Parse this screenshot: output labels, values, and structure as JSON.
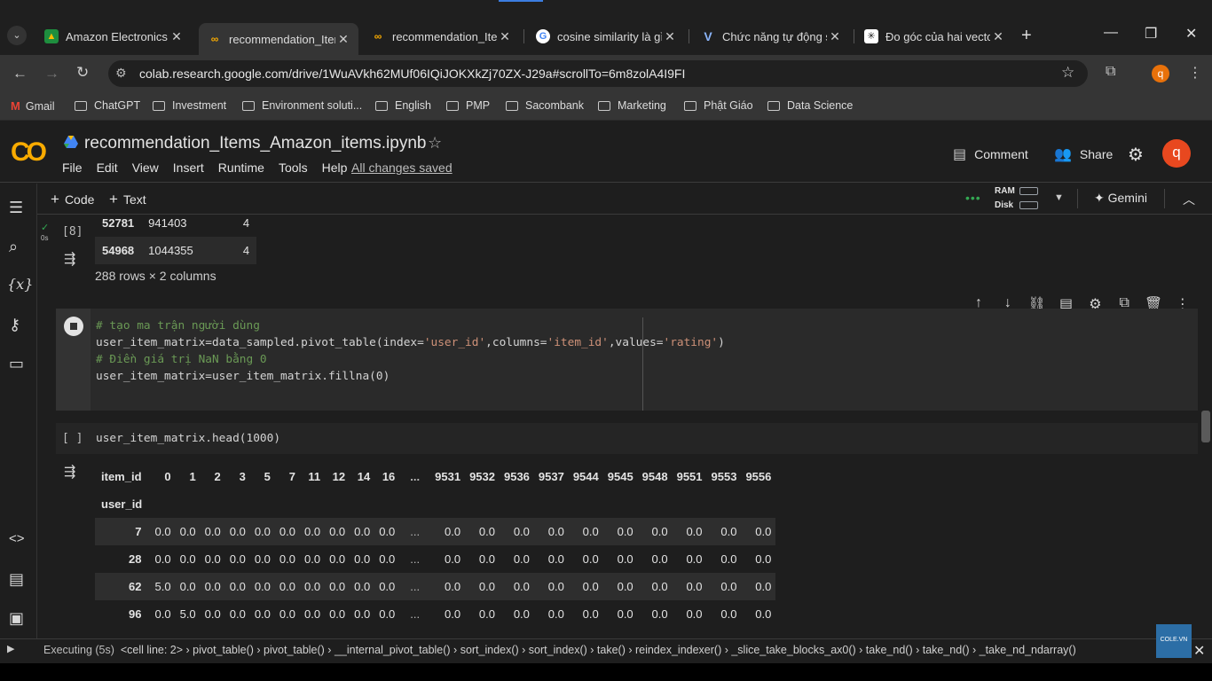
{
  "browser": {
    "tabs": [
      {
        "label": "Amazon Electronics P",
        "favicon": "drive-icon"
      },
      {
        "label": "recommendation_Iter",
        "favicon": "colab-icon",
        "active": true
      },
      {
        "label": "recommendation_Iter",
        "favicon": "colab-icon"
      },
      {
        "label": "cosine similarity là gì",
        "favicon": "google-icon"
      },
      {
        "label": "Chức năng tự động s",
        "favicon": "v-icon"
      },
      {
        "label": "Đo góc của hai vectơ",
        "favicon": "gemini-icon"
      }
    ],
    "url": "colab.research.google.com/drive/1WuAVkh62MUf06IQiJOKXkZj70ZX-J29a#scrollTo=6m8zolA4I9FI",
    "profile_initial": "q",
    "bookmarks": [
      "Gmail",
      "ChatGPT",
      "Investment",
      "Environment soluti...",
      "English",
      "PMP",
      "Sacombank",
      "Marketing",
      "Phật Giáo",
      "Data Science"
    ]
  },
  "colab": {
    "logo": "CO",
    "title": "recommendation_Items_Amazon_items.ipynb",
    "menu": [
      "File",
      "Edit",
      "View",
      "Insert",
      "Runtime",
      "Tools",
      "Help"
    ],
    "saved": "All changes saved",
    "comment": "Comment",
    "share": "Share",
    "avatar": "q",
    "add_code": "Code",
    "add_text": "Text",
    "ram": "RAM",
    "disk": "Disk",
    "gemini": "Gemini"
  },
  "cell_prev": {
    "exec": "[8]",
    "exec_time": "0s",
    "rows": [
      [
        "52781",
        "941403",
        "4"
      ],
      [
        "54968",
        "1044355",
        "4"
      ]
    ],
    "info": "288 rows × 2 columns"
  },
  "cell1": {
    "line1": "# tạo ma trận người dùng",
    "line2_a": "user_item_matrix=data_sampled.pivot_table(index=",
    "line2_s1": "'user_id'",
    "line2_b": ",columns=",
    "line2_s2": "'item_id'",
    "line2_c": ",values=",
    "line2_s3": "'rating'",
    "line2_d": ")",
    "line3": "# Điền giá trị NaN bằng 0",
    "line4": "user_item_matrix=user_item_matrix.fillna(0)"
  },
  "cell2": {
    "exec": "[ ]",
    "code": "user_item_matrix.head(1000)"
  },
  "dataframe": {
    "col_header_label": "item_id",
    "row_header_label": "user_id",
    "columns": [
      "0",
      "1",
      "2",
      "3",
      "5",
      "7",
      "11",
      "12",
      "14",
      "16",
      "...",
      "9531",
      "9532",
      "9536",
      "9537",
      "9544",
      "9545",
      "9548",
      "9551",
      "9553",
      "9556"
    ],
    "rows": [
      {
        "id": "7",
        "values": [
          "0.0",
          "0.0",
          "0.0",
          "0.0",
          "0.0",
          "0.0",
          "0.0",
          "0.0",
          "0.0",
          "0.0",
          "...",
          "0.0",
          "0.0",
          "0.0",
          "0.0",
          "0.0",
          "0.0",
          "0.0",
          "0.0",
          "0.0",
          "0.0"
        ]
      },
      {
        "id": "28",
        "values": [
          "0.0",
          "0.0",
          "0.0",
          "0.0",
          "0.0",
          "0.0",
          "0.0",
          "0.0",
          "0.0",
          "0.0",
          "...",
          "0.0",
          "0.0",
          "0.0",
          "0.0",
          "0.0",
          "0.0",
          "0.0",
          "0.0",
          "0.0",
          "0.0"
        ]
      },
      {
        "id": "62",
        "values": [
          "5.0",
          "0.0",
          "0.0",
          "0.0",
          "0.0",
          "0.0",
          "0.0",
          "0.0",
          "0.0",
          "0.0",
          "...",
          "0.0",
          "0.0",
          "0.0",
          "0.0",
          "0.0",
          "0.0",
          "0.0",
          "0.0",
          "0.0",
          "0.0"
        ]
      },
      {
        "id": "96",
        "values": [
          "0.0",
          "5.0",
          "0.0",
          "0.0",
          "0.0",
          "0.0",
          "0.0",
          "0.0",
          "0.0",
          "0.0",
          "...",
          "0.0",
          "0.0",
          "0.0",
          "0.0",
          "0.0",
          "0.0",
          "0.0",
          "0.0",
          "0.0",
          "0.0"
        ]
      }
    ]
  },
  "status": {
    "executing": "Executing (5s)",
    "trace": "<cell line: 2> › pivot_table() › pivot_table() › __internal_pivot_table() › sort_index() › sort_index() › take() › reindex_indexer() › _slice_take_blocks_ax0() › take_nd() › take_nd() › _take_nd_ndarray()"
  },
  "watermark": "COLE.VN"
}
